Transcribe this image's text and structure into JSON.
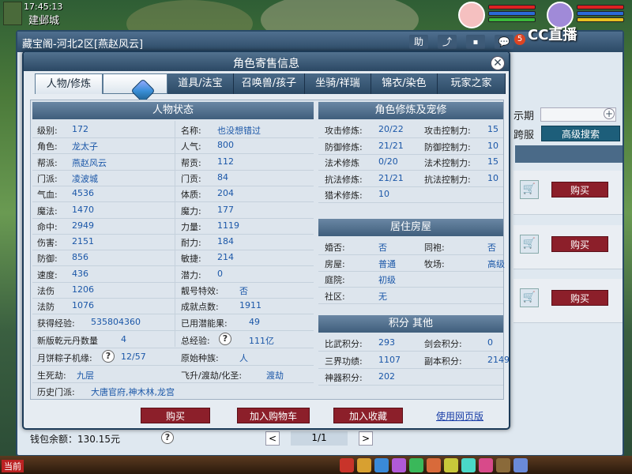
{
  "hud": {
    "time": "17:45:13",
    "city": "建邺城"
  },
  "watermark": "CC直播",
  "notification_count": "5",
  "background_window": {
    "title": "藏宝阁-河北2区[燕赵风云]",
    "toolbar": [
      "助",
      "⤴",
      "⏹",
      "💬"
    ],
    "right_labels": {
      "period": "示期",
      "cross_server": "跨服"
    },
    "advanced_search": "高级搜索",
    "buy_label": "购买",
    "wallet": "钱包余额：130.15元",
    "help": "?",
    "page_prev": "<",
    "page_indicator": "1/1",
    "page_next": ">"
  },
  "dialog": {
    "title": "角色寄售信息",
    "close": "✕",
    "tabs": [
      "人物/修炼",
      "",
      "道具/法宝",
      "召唤兽/孩子",
      "坐骑/祥瑞",
      "锦衣/染色",
      "玩家之家"
    ],
    "status": {
      "header": "人物状态",
      "left": [
        {
          "k": "级别:",
          "v": "172"
        },
        {
          "k": "角色:",
          "v": "龙太子"
        },
        {
          "k": "帮派:",
          "v": "燕赵风云"
        },
        {
          "k": "门派:",
          "v": "凌波城"
        },
        {
          "k": "气血:",
          "v": "4536"
        },
        {
          "k": "魔法:",
          "v": "1470"
        },
        {
          "k": "命中:",
          "v": "2949"
        },
        {
          "k": "伤害:",
          "v": "2151"
        },
        {
          "k": "防御:",
          "v": "856"
        },
        {
          "k": "速度:",
          "v": "436"
        },
        {
          "k": "法伤",
          "v": "1206"
        },
        {
          "k": "法防",
          "v": "1076"
        }
      ],
      "right": [
        {
          "k": "名称:",
          "v": "也没想错过"
        },
        {
          "k": "人气:",
          "v": "800"
        },
        {
          "k": "帮贡:",
          "v": "112"
        },
        {
          "k": "门贡:",
          "v": "84"
        },
        {
          "k": "体质:",
          "v": "204"
        },
        {
          "k": "魔力:",
          "v": "177"
        },
        {
          "k": "力量:",
          "v": "1119"
        },
        {
          "k": "耐力:",
          "v": "184"
        },
        {
          "k": "敏捷:",
          "v": "214"
        },
        {
          "k": "潜力:",
          "v": "0"
        },
        {
          "k": "靓号特效:",
          "v": "否"
        },
        {
          "k": "成就点数:",
          "v": "1911"
        }
      ],
      "exp": {
        "k": "获得经验:",
        "v": "535804360"
      },
      "unused_potential": {
        "k": "已用潜能果:",
        "v": "49"
      },
      "qianyuan": {
        "k": "新版乾元丹数量",
        "v": "4"
      },
      "total_exp": {
        "k": "总经验:",
        "v": "111亿"
      },
      "mooncake": {
        "k": "月饼粽子机缘:",
        "v": "12/57"
      },
      "race": {
        "k": "原始种族:",
        "v": "人"
      },
      "birth": {
        "k": "生死劫:",
        "v": "九层"
      },
      "ascend": {
        "k": "飞升/渡劫/化圣:",
        "v": "渡劫"
      },
      "history": {
        "k": "历史门派:",
        "v": "大唐官府,神木林,龙宫"
      }
    },
    "cultivation": {
      "header": "角色修炼及宠修",
      "rows": [
        {
          "k1": "攻击修炼:",
          "v1": "20/22",
          "k2": "攻击控制力:",
          "v2": "15"
        },
        {
          "k1": "防御修炼:",
          "v1": "21/21",
          "k2": "防御控制力:",
          "v2": "10"
        },
        {
          "k1": "法术修炼",
          "v1": "0/20",
          "k2": "法术控制力:",
          "v2": "15"
        },
        {
          "k1": "抗法修炼:",
          "v1": "21/21",
          "k2": "抗法控制力:",
          "v2": "10"
        },
        {
          "k1": "猎术修炼:",
          "v1": "10",
          "k2": "",
          "v2": ""
        }
      ]
    },
    "house": {
      "header": "居住房屋",
      "rows": [
        {
          "k1": "婚否:",
          "v1": "否",
          "k2": "同袍:",
          "v2": "否"
        },
        {
          "k1": "房屋:",
          "v1": "普通",
          "k2": "牧场:",
          "v2": "高级"
        },
        {
          "k1": "庭院:",
          "v1": "初级",
          "k2": "",
          "v2": ""
        },
        {
          "k1": "社区:",
          "v1": "无",
          "k2": "",
          "v2": ""
        }
      ]
    },
    "points": {
      "header": "积分 其他",
      "rows": [
        {
          "k1": "比武积分:",
          "v1": "293",
          "k2": "剑会积分:",
          "v2": "0"
        },
        {
          "k1": "三界功绩:",
          "v1": "1107",
          "k2": "副本积分:",
          "v2": "2149"
        },
        {
          "k1": "神器积分:",
          "v1": "202",
          "k2": "",
          "v2": ""
        }
      ]
    },
    "buttons": {
      "buy": "购买",
      "add_cart": "加入购物车",
      "add_fav": "加入收藏",
      "web": "使用网页版"
    }
  },
  "taskbar": {
    "label": "当前"
  }
}
